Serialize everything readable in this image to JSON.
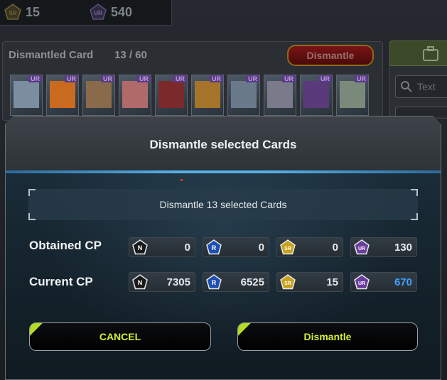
{
  "points": {
    "sr_value": "15",
    "ur_value": "540"
  },
  "card_panel": {
    "title": "Dismantled Card",
    "count": "13 / 60",
    "dismantle_label": "Dismantle",
    "card_rarity": "UR",
    "cards_visible": 10
  },
  "side": {
    "search_placeholder": "Text"
  },
  "dialog": {
    "title": "Dismantle selected Cards",
    "message": "Dismantle 13 selected Cards",
    "rarity_labels": [
      "N",
      "R",
      "SR",
      "UR"
    ],
    "obtained": {
      "label": "Obtained CP",
      "values": [
        "0",
        "0",
        "0",
        "130"
      ]
    },
    "current": {
      "label": "Current CP",
      "values": [
        "7305",
        "6525",
        "15",
        "670"
      ]
    },
    "cancel_label": "CANCEL",
    "confirm_label": "Dismantle"
  },
  "colors": {
    "accent_green": "#d6f032",
    "highlight_blue": "#3fa2ff",
    "header_line": "#58b0e8",
    "N": "#1a1a1a",
    "R": "#1e4fb0",
    "SR": "#c9a21c",
    "UR": "#6a3c9c"
  }
}
